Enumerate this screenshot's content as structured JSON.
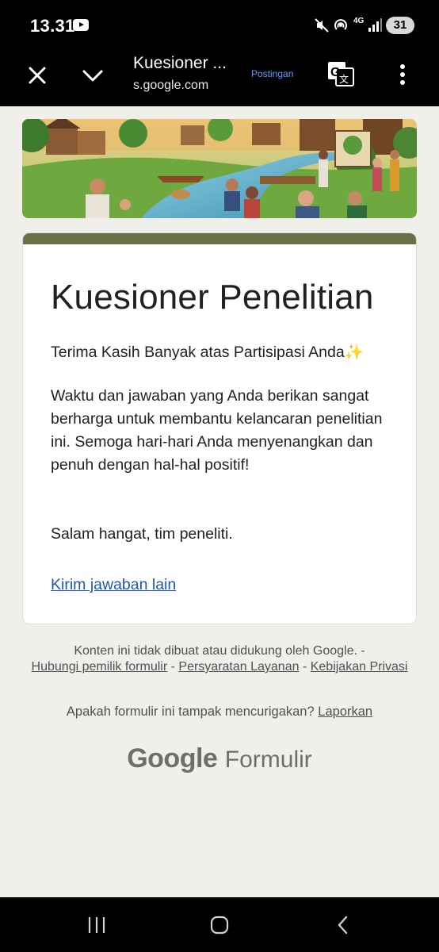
{
  "status": {
    "time": "13.31",
    "network": "4G",
    "battery": "31",
    "icons": [
      "youtube-icon",
      "mute-icon",
      "hotspot-icon",
      "signal-icon"
    ]
  },
  "browser": {
    "title": "Kuesioner ...",
    "url": "s.google.com",
    "postingan": "Postingan",
    "icons": [
      "close-icon",
      "chevron-down-icon",
      "translate-icon",
      "more-vert-icon"
    ]
  },
  "banner": {
    "description_icon": "community-illustration"
  },
  "form": {
    "accent_color": "#6b6f45",
    "title": "Kuesioner Penelitian",
    "thanks": "Terima Kasih Banyak atas Partisipasi Anda✨",
    "paragraph": "Waktu dan jawaban yang Anda berikan sangat berharga untuk membantu kelancaran penelitian ini. Semoga hari-hari Anda menyenangkan dan penuh dengan hal-hal positif!",
    "closing": "Salam hangat, tim peneliti.",
    "another_response": "Kirim jawaban lain"
  },
  "footer": {
    "disclaimer": "Konten ini tidak dibuat atau didukung oleh Google. -",
    "contact_owner": "Hubungi pemilik formulir",
    "sep1": " - ",
    "terms": "Persyaratan Layanan",
    "sep2": " - ",
    "privacy": "Kebijakan Privasi",
    "suspicious": "Apakah formulir ini tampak mencurigakan?",
    "report": "Laporkan",
    "brand_google": "Google",
    "brand_forms": "Formulir"
  },
  "navbar": {
    "icons": [
      "recents-icon",
      "home-icon",
      "back-icon"
    ]
  }
}
